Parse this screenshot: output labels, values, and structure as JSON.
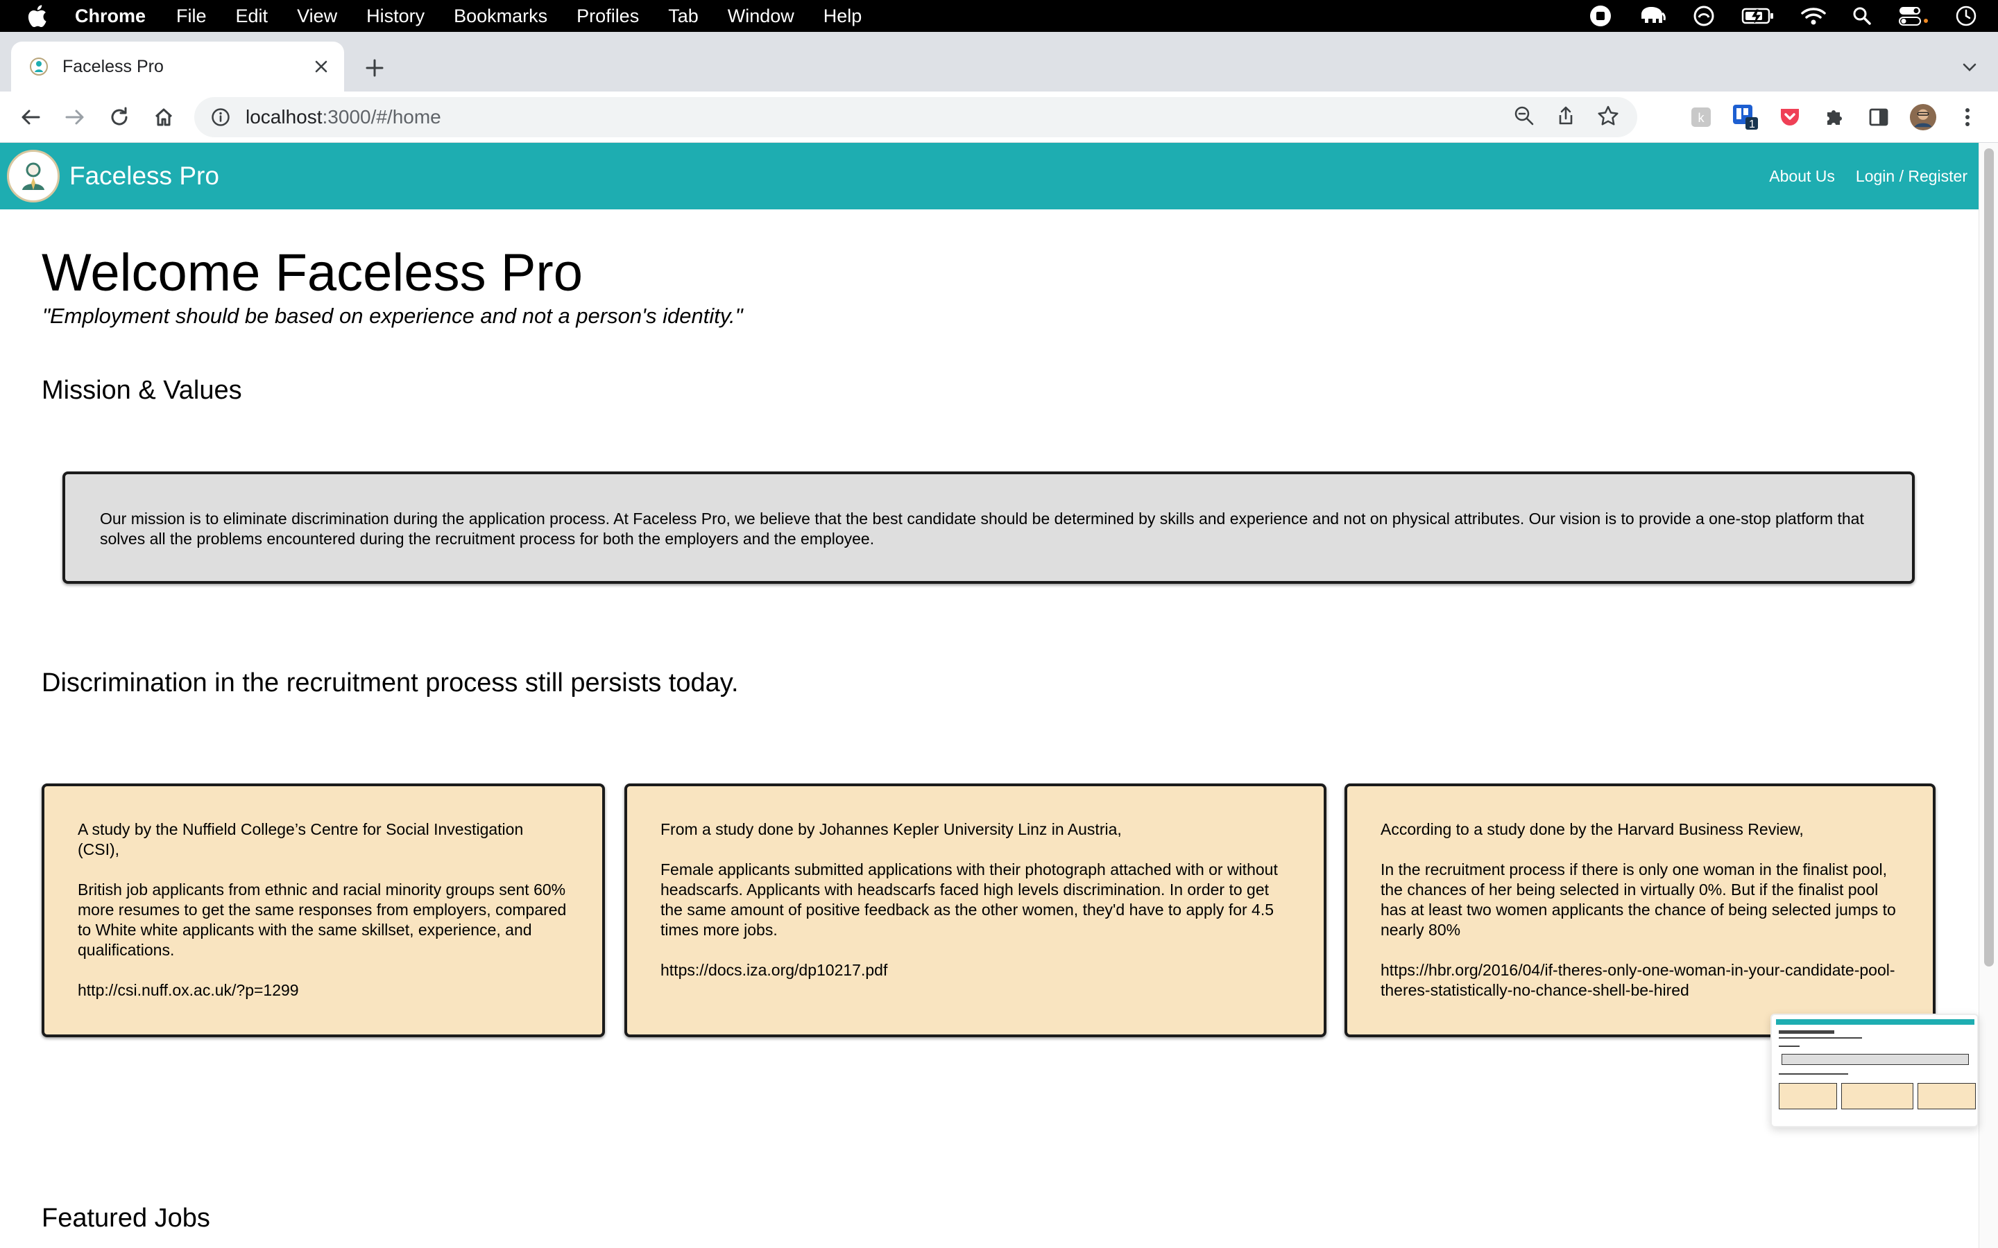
{
  "menubar": {
    "app_name": "Chrome",
    "items": [
      "File",
      "Edit",
      "View",
      "History",
      "Bookmarks",
      "Profiles",
      "Tab",
      "Window",
      "Help"
    ]
  },
  "browser": {
    "tab_title": "Faceless Pro",
    "url_host": "localhost",
    "url_rest": ":3000/#/home",
    "extension_badge": "1"
  },
  "navbar": {
    "brand": "Faceless Pro",
    "links": [
      "About Us",
      "Login / Register"
    ],
    "color": "#1eadb1"
  },
  "page": {
    "title": "Welcome Faceless Pro",
    "quote": "\"Employment should be based on experience and not a person's identity.\"",
    "mission_heading": "Mission & Values",
    "mission_text": "Our mission is to eliminate discrimination during the application process. At Faceless Pro, we believe that the best candidate should be determined by skills and experience and not on physical attributes. Our vision is to provide a one-stop platform that solves all the problems encountered during the recruitment process for both the employers and the employee.",
    "discrimination_heading": "Discrimination in the recruitment process still persists today.",
    "featured_heading": "Featured Jobs"
  },
  "cards": [
    {
      "intro": "A study by the Nuffield College’s Centre for Social Investigation (CSI),",
      "body": "British job applicants from ethnic and racial minority groups sent 60% more resumes to get the same responses from employers, compared to White white applicants with the same skillset, experience, and qualifications.",
      "link": "http://csi.nuff.ox.ac.uk/?p=1299"
    },
    {
      "intro": "From a study done by Johannes Kepler University Linz in Austria,",
      "body": "Female applicants submitted applications with their photograph attached with or without headscarfs. Applicants with headscarfs faced high levels discrimination. In order to get the same amount of positive feedback as the other women, they'd have to apply for 4.5 times more jobs.",
      "link": "https://docs.iza.org/dp10217.pdf"
    },
    {
      "intro": "According to a study done by the Harvard Business Review,",
      "body": "In the recruitment process if there is only one woman in the finalist pool, the chances of her being selected in virtually 0%. But if the finalist pool has at least two women applicants the chance of being selected jumps to nearly 80%",
      "link": "https://hbr.org/2016/04/if-theres-only-one-woman-in-your-candidate-pool-theres-statistically-no-chance-shell-be-hired"
    }
  ]
}
